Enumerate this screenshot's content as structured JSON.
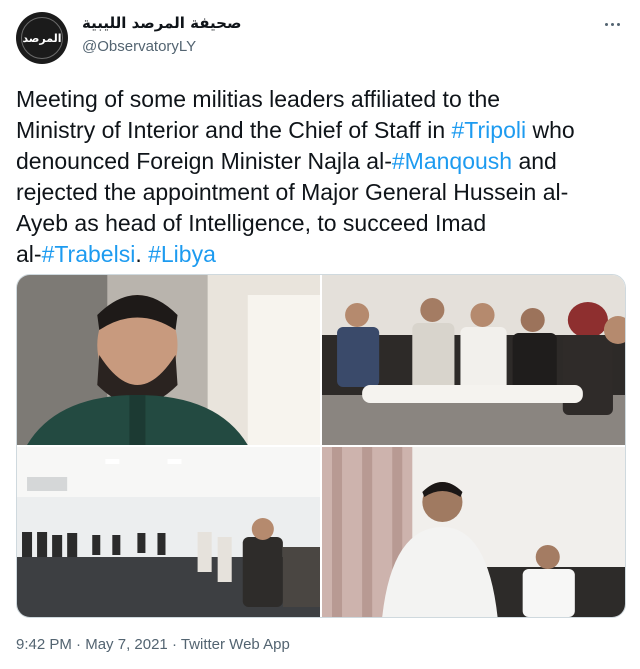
{
  "account": {
    "display_name": "صحيفة المرصد الليبية",
    "handle": "@ObservatoryLY",
    "avatar_text": "المرصد"
  },
  "tweet": {
    "lines": [
      [
        {
          "text": "Meeting of some militias leaders affiliated to the",
          "tag": false
        }
      ],
      [
        {
          "text": "Ministry of Interior and the Chief of Staff in ",
          "tag": false
        },
        {
          "text": "#Tripoli",
          "tag": true
        },
        {
          "text": " who",
          "tag": false
        }
      ],
      [
        {
          "text": "denounced Foreign Minister Najla al-",
          "tag": false
        },
        {
          "text": "#Manqoush",
          "tag": true
        },
        {
          "text": " and",
          "tag": false
        }
      ],
      [
        {
          "text": "rejected the appointment of Major General Hussein al-",
          "tag": false
        }
      ],
      [
        {
          "text": "Ayeb as head of Intelligence, to succeed Imad",
          "tag": false
        }
      ],
      [
        {
          "text": "al-",
          "tag": false
        },
        {
          "text": "#Trabelsi",
          "tag": true
        },
        {
          "text": ". ",
          "tag": false
        },
        {
          "text": "#Libya",
          "tag": true
        }
      ]
    ]
  },
  "meta": {
    "time": "9:42 PM",
    "separator": " · ",
    "date": "May 7, 2021",
    "source": "Twitter Web App"
  },
  "colors": {
    "hashtag": "#1d9bf0",
    "secondary_text": "#536471",
    "primary_text": "#0f1419"
  }
}
